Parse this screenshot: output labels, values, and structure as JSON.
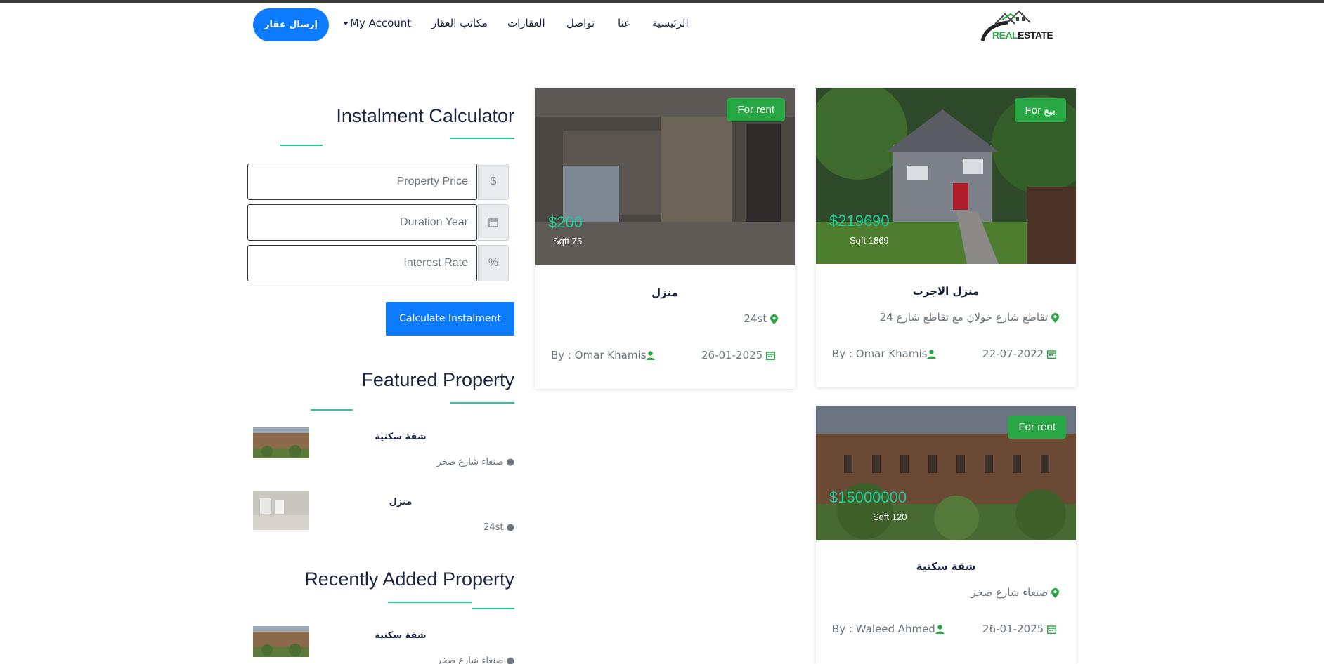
{
  "brand": {
    "logo_green": "REAL",
    "logo_dark": "ESTATE"
  },
  "nav": {
    "items": [
      "الرئيسية",
      "عنا",
      "تواصل",
      "العقارات",
      "مكاتب العقار",
      "My Account"
    ],
    "send_button": "إرسال عقار"
  },
  "calculator": {
    "title": "Instalment Calculator",
    "price_placeholder": "Property Price",
    "price_addon": "$",
    "duration_placeholder": "Duration Year",
    "duration_addon_icon": "calendar-icon",
    "rate_placeholder": "Interest Rate",
    "rate_addon": "%",
    "button": "Calculate Instalment"
  },
  "featured": {
    "title": "Featured Property",
    "items": [
      {
        "title": "شقة سكنية",
        "location": "صنعاء شارع صخر"
      },
      {
        "title": "منزل",
        "location": "24st"
      }
    ]
  },
  "recent": {
    "title": "Recently Added Property",
    "items": [
      {
        "title": "شقة سكنية",
        "location": "صنعاء شارع صخر"
      }
    ]
  },
  "properties": [
    {
      "badge": "For rent",
      "price": "$200",
      "sqft": "Sqft 75",
      "title": "منزل",
      "location": "24st",
      "author": "By : Omar Khamis",
      "date": "26-01-2025"
    },
    {
      "badge": "For بيع",
      "price": "$219690",
      "sqft": "Sqft 1869",
      "title": "منزل الاجرب",
      "location": "تقاطع شارع خولان مع تقاطع شارع 24",
      "author": "By : Omar Khamis",
      "date": "22-07-2022"
    },
    {
      "badge": "For rent",
      "price": "$15000000",
      "sqft": "Sqft 120",
      "title": "شقة سكنية",
      "location": "صنعاء شارع صخر",
      "author": "By : Waleed Ahmed",
      "date": "26-01-2025"
    }
  ],
  "colors": {
    "accent": "#20c997",
    "primary": "#0d7bff",
    "badge": "#28a745",
    "text": "#1b2440",
    "muted": "#6c757d"
  }
}
